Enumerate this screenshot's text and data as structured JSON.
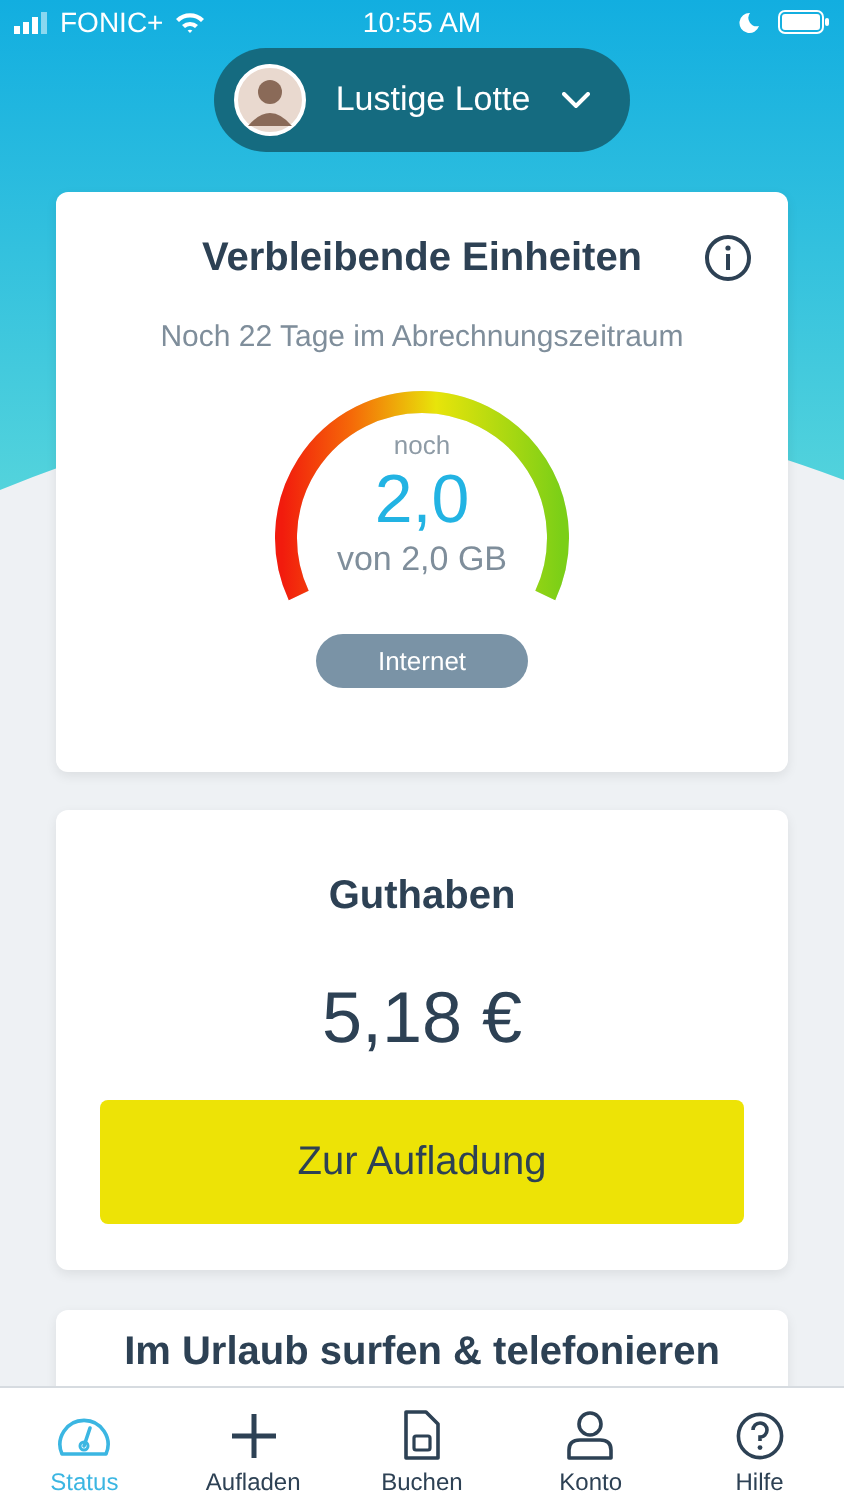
{
  "status_bar": {
    "carrier": "FONIC+",
    "time": "10:55 AM"
  },
  "profile": {
    "name": "Lustige Lotte"
  },
  "units_card": {
    "title": "Verbleibende Einheiten",
    "subtitle": "Noch 22 Tage im Abrechnungszeitraum",
    "gauge": {
      "prefix": "noch",
      "value": "2,0",
      "total": "von 2,0 GB"
    },
    "tag": "Internet"
  },
  "balance_card": {
    "title": "Guthaben",
    "amount": "5,18 €",
    "button": "Zur Aufladung"
  },
  "promo_card": {
    "title": "Im Urlaub surfen & telefonieren"
  },
  "tab_bar": [
    {
      "label": "Status",
      "kind": "gauge",
      "selected": true
    },
    {
      "label": "Aufladen",
      "kind": "plus",
      "selected": false
    },
    {
      "label": "Buchen",
      "kind": "sim",
      "selected": false
    },
    {
      "label": "Konto",
      "kind": "person",
      "selected": false
    },
    {
      "label": "Hilfe",
      "kind": "help",
      "selected": false
    }
  ]
}
